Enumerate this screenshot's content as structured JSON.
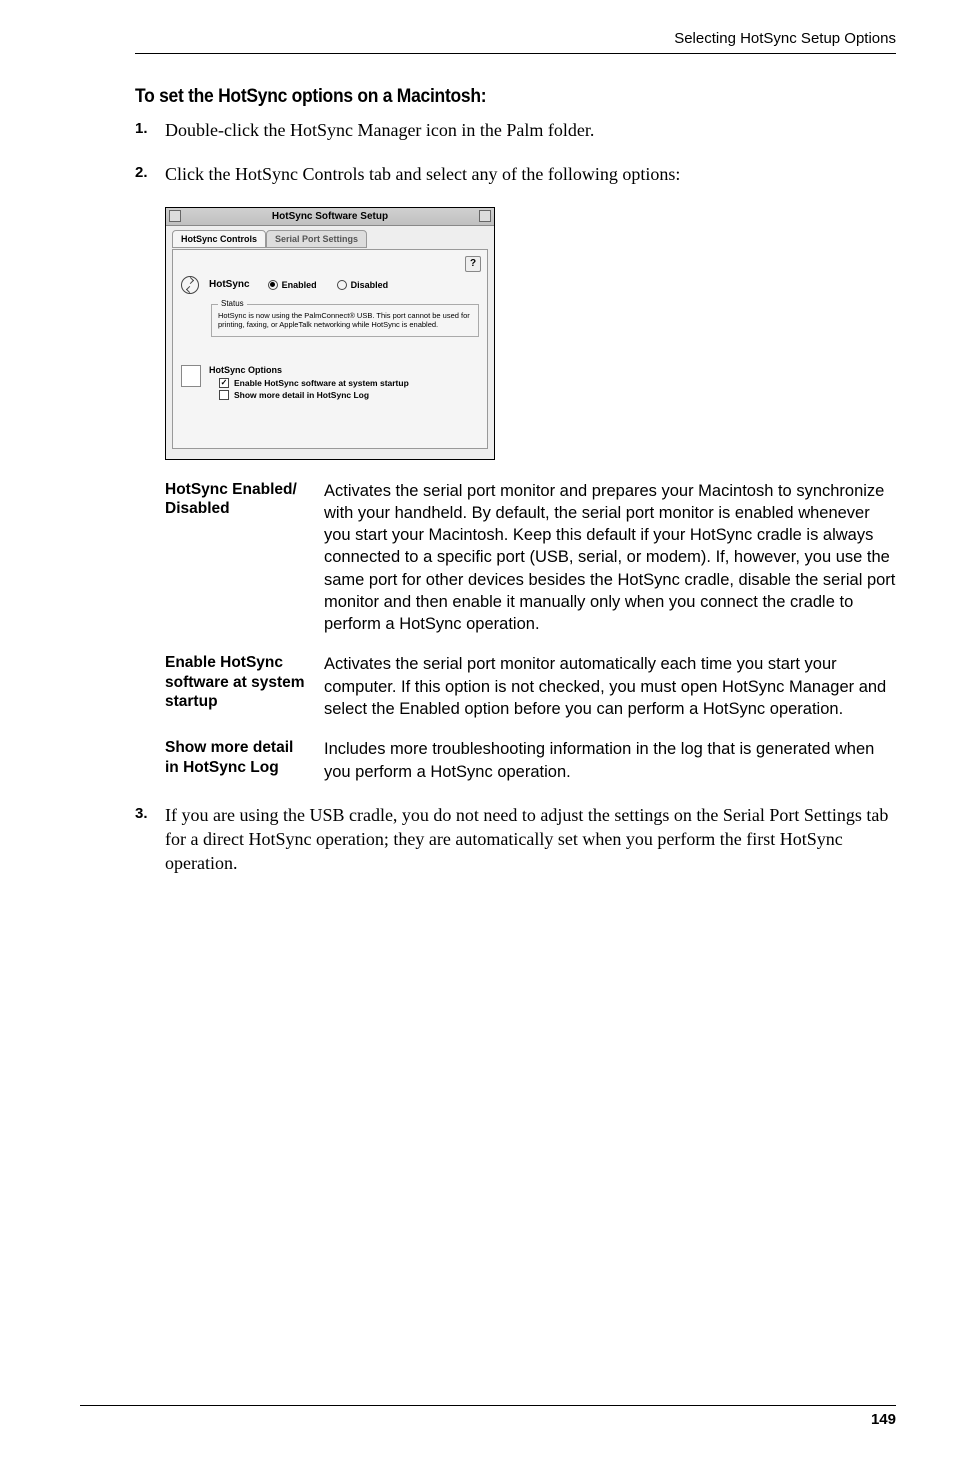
{
  "header": "Selecting HotSync Setup Options",
  "section_title": "To set the HotSync options on a Macintosh:",
  "steps": {
    "s1": {
      "num": "1.",
      "text": "Double-click the HotSync Manager icon in the Palm folder."
    },
    "s2": {
      "num": "2.",
      "text": "Click the HotSync Controls tab and select any of the following options:"
    },
    "s3": {
      "num": "3.",
      "text": "If you are using the USB cradle, you do not need to adjust the settings on the Serial Port Settings tab for a direct HotSync operation; they are automatically set when you perform the first HotSync operation."
    }
  },
  "dialog": {
    "title": "HotSync Software Setup",
    "tabs": {
      "controls": "HotSync Controls",
      "serial": "Serial Port Settings"
    },
    "help": "?",
    "hotsync_label": "HotSync",
    "enabled": "Enabled",
    "disabled": "Disabled",
    "status_legend": "Status",
    "status_text": "HotSync is now using the PalmConnect® USB. This port cannot be used for printing, faxing, or AppleTalk networking while HotSync is enabled.",
    "options_title": "HotSync Options",
    "cb1": "Enable HotSync software at system startup",
    "cb2": "Show more detail in HotSync Log"
  },
  "options": {
    "r1": {
      "term": "HotSync Enabled/ Disabled",
      "desc": "Activates the serial port monitor and prepares your Macintosh to synchronize with your handheld. By default, the serial port monitor is enabled whenever you start your Macintosh. Keep this default if your HotSync cradle is always connected to a specific port (USB, serial, or modem). If, however, you use the same port for other devices besides the HotSync cradle, disable the serial port monitor and then enable it manually only when you connect the cradle to perform a HotSync operation."
    },
    "r2": {
      "term": "Enable HotSync software at system startup",
      "desc": "Activates the serial port monitor automatically each time you start your computer. If this option is not checked, you must open HotSync Manager and select the Enabled option before you can perform a HotSync operation."
    },
    "r3": {
      "term": "Show more detail in HotSync Log",
      "desc": "Includes more troubleshooting information in the log that is generated when you perform a HotSync operation."
    }
  },
  "page_number": "149"
}
